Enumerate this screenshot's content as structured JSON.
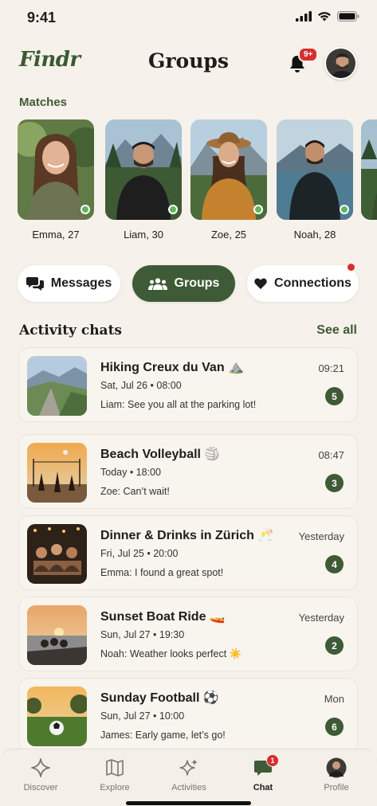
{
  "status_bar": {
    "time": "9:41"
  },
  "header": {
    "logo": "Findr",
    "title": "Groups",
    "notification_badge": "9+"
  },
  "matches": {
    "label": "Matches",
    "items": [
      {
        "name": "Emma, 27",
        "online": true
      },
      {
        "name": "Liam, 30",
        "online": true
      },
      {
        "name": "Zoe, 25",
        "online": true
      },
      {
        "name": "Noah, 28",
        "online": true
      }
    ]
  },
  "tabs": [
    {
      "label": "Messages",
      "icon": "chat-bubbles-icon",
      "active": false
    },
    {
      "label": "Groups",
      "icon": "group-icon",
      "active": true
    },
    {
      "label": "Connections",
      "icon": "heart-icon",
      "active": false,
      "has_dot": true
    }
  ],
  "activity": {
    "title": "Activity chats",
    "see_all": "See all",
    "chats": [
      {
        "title": "Hiking Creux du Van ⛰️",
        "date": "Sat, Jul 26 • 08:00",
        "message": "Liam: See you all at the parking lot!",
        "time": "09:21",
        "count": "5"
      },
      {
        "title": "Beach Volleyball 🏐",
        "date": "Today • 18:00",
        "message": "Zoe: Can’t wait!",
        "time": "08:47",
        "count": "3"
      },
      {
        "title": "Dinner & Drinks in Zürich 🥂",
        "date": "Fri, Jul 25 • 20:00",
        "message": "Emma: I found a great spot!",
        "time": "Yesterday",
        "count": "4"
      },
      {
        "title": "Sunset Boat Ride 🚤",
        "date": "Sun, Jul 27 • 19:30",
        "message": "Noah: Weather looks perfect ☀️",
        "time": "Yesterday",
        "count": "2"
      },
      {
        "title": "Sunday Football ⚽",
        "date": "Sun, Jul 27 • 10:00",
        "message": "James: Early game, let’s go!",
        "time": "Mon",
        "count": "6"
      }
    ]
  },
  "bottom_nav": [
    {
      "label": "Discover",
      "icon": "sparkle-icon"
    },
    {
      "label": "Explore",
      "icon": "map-icon"
    },
    {
      "label": "Activities",
      "icon": "stars-icon"
    },
    {
      "label": "Chat",
      "icon": "chat-icon",
      "active": true,
      "badge": "1"
    },
    {
      "label": "Profile",
      "icon": "avatar-icon"
    }
  ],
  "colors": {
    "background": "#f6f1ea",
    "accent": "#3e5a36",
    "badge": "#d72e2e",
    "online": "#5db562"
  }
}
